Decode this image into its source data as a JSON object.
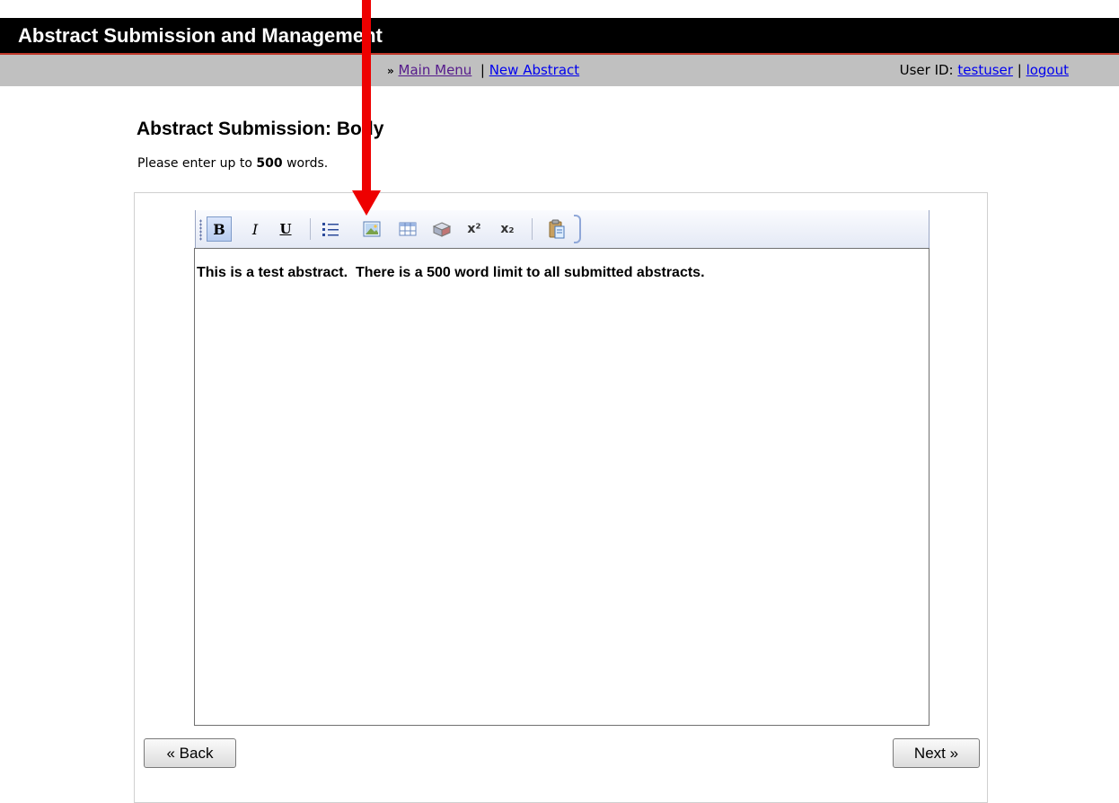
{
  "app": {
    "title": "Abstract Submission and Management"
  },
  "nav": {
    "separator_glyph": "»",
    "main_menu": "Main Menu",
    "divider": "|",
    "new_abstract": "New Abstract",
    "user_id_label": "User ID:",
    "username": "testuser",
    "logout": "logout"
  },
  "page": {
    "heading": "Abstract Submission: Body",
    "instructions_prefix": "Please enter up to ",
    "word_limit": "500",
    "instructions_suffix": " words."
  },
  "toolbar": {
    "buttons": [
      {
        "name": "bold-button",
        "glyph": "B",
        "active": true
      },
      {
        "name": "italic-button",
        "glyph": "I"
      },
      {
        "name": "underline-button",
        "glyph": "U"
      },
      {
        "name": "bulleted-list-button",
        "icon": "list-icon"
      },
      {
        "name": "insert-image-button",
        "icon": "image-icon"
      },
      {
        "name": "insert-table-button",
        "icon": "table-icon"
      },
      {
        "name": "special-character-button",
        "icon": "special-char-icon"
      },
      {
        "name": "superscript-button",
        "glyph": "x²"
      },
      {
        "name": "subscript-button",
        "glyph": "x₂"
      },
      {
        "name": "paste-button",
        "icon": "paste-icon"
      }
    ]
  },
  "editor": {
    "content": "This is a test abstract.  There is a 500 word limit to all submitted abstracts."
  },
  "buttons": {
    "back": "« Back",
    "next": "Next »"
  },
  "colors": {
    "title_bar_bg": "#000000",
    "nav_bar_bg": "#c0c0c0",
    "arrow": "#ee0000",
    "link": "#0000ee",
    "link_visited": "#551a8b"
  }
}
